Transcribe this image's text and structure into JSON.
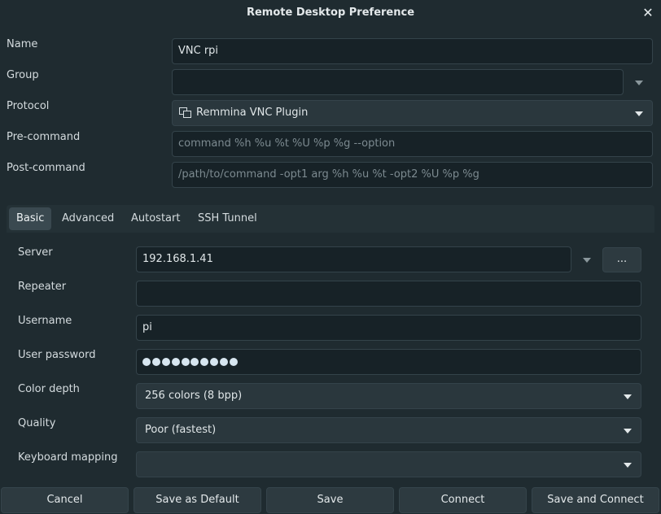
{
  "window": {
    "title": "Remote Desktop Preference",
    "close_icon": "✕"
  },
  "profile": {
    "name": {
      "label": "Name",
      "value": "VNC rpi"
    },
    "group": {
      "label": "Group",
      "value": ""
    },
    "protocol": {
      "label": "Protocol",
      "value": "Remmina VNC Plugin",
      "icon": "plugin-icon"
    },
    "pre_command": {
      "label": "Pre-command",
      "placeholder": "command %h %u %t %U %p %g --option"
    },
    "post_command": {
      "label": "Post-command",
      "placeholder": "/path/to/command -opt1 arg %h %u %t -opt2 %U %p %g"
    }
  },
  "tabs": [
    {
      "label": "Basic",
      "active": true
    },
    {
      "label": "Advanced",
      "active": false
    },
    {
      "label": "Autostart",
      "active": false
    },
    {
      "label": "SSH Tunnel",
      "active": false
    }
  ],
  "basic": {
    "server": {
      "label": "Server",
      "value": "192.168.1.41",
      "browse_label": "..."
    },
    "repeater": {
      "label": "Repeater",
      "value": ""
    },
    "username": {
      "label": "Username",
      "value": "pi"
    },
    "password": {
      "label": "User password",
      "masked_length": 10
    },
    "color_depth": {
      "label": "Color depth",
      "value": "256 colors (8 bpp)"
    },
    "quality": {
      "label": "Quality",
      "value": "Poor (fastest)"
    },
    "keyboard_mapping": {
      "label": "Keyboard mapping",
      "value": ""
    }
  },
  "buttons": {
    "cancel": "Cancel",
    "save_default": "Save as Default",
    "save": "Save",
    "connect": "Connect",
    "save_connect": "Save and Connect"
  },
  "colors": {
    "background": "#1f2b30",
    "entry": "#172227",
    "button": "#2d3a40",
    "active_tab": "#3a4950"
  }
}
